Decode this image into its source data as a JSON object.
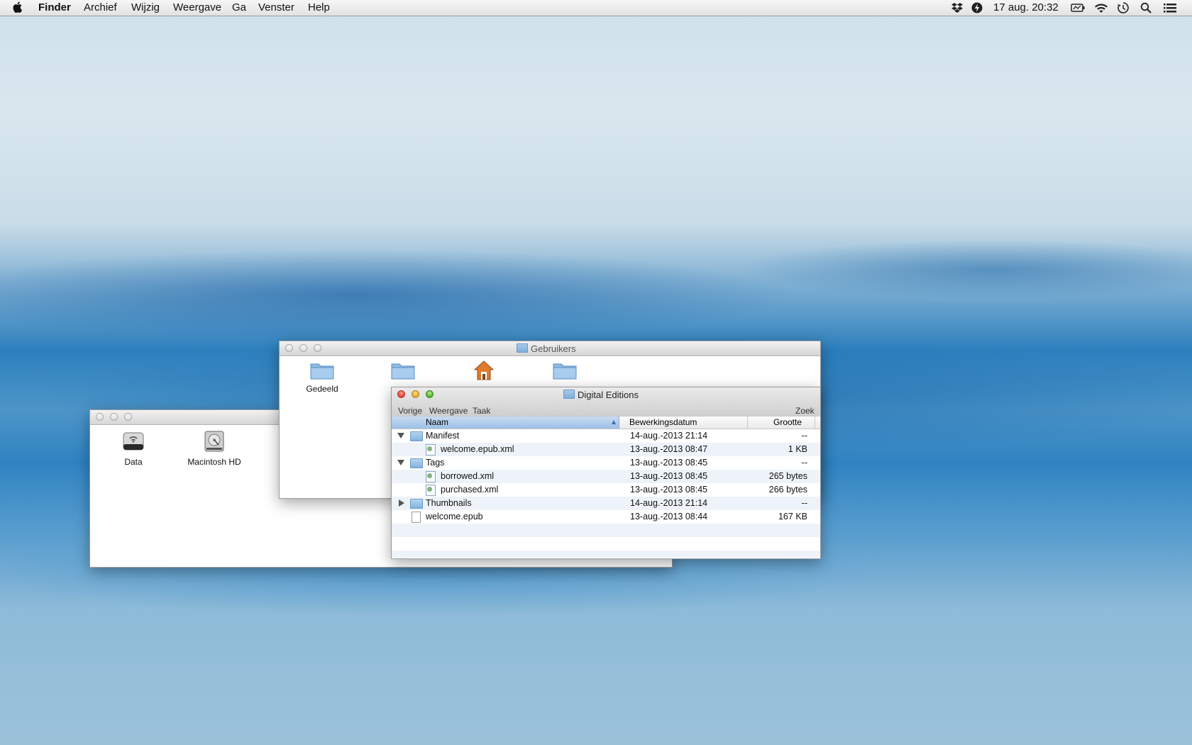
{
  "menubar": {
    "app": "Finder",
    "items": [
      "Archief",
      "Wijzig",
      "Weergave",
      "Ga",
      "Venster",
      "Help"
    ],
    "clock": "17 aug.  20:32",
    "status_icons": [
      "dropbox-icon",
      "flash-icon",
      "battery-icon",
      "wifi-icon",
      "time-machine-icon",
      "spotlight-icon",
      "list-icon"
    ]
  },
  "window_devices": {
    "items": [
      {
        "label": "Data",
        "icon": "network-drive-icon"
      },
      {
        "label": "Macintosh HD",
        "icon": "hard-drive-icon"
      }
    ]
  },
  "window_users": {
    "title": "Gebruikers",
    "items": [
      {
        "label": "Gedeeld",
        "icon": "folder-icon"
      },
      {
        "label": "",
        "icon": "folder-icon"
      },
      {
        "label": "",
        "icon": "home-icon"
      },
      {
        "label": "",
        "icon": "folder-icon"
      }
    ]
  },
  "window_digital": {
    "title": "Digital Editions",
    "toolbar": {
      "back": "Vorige",
      "view": "Weergave",
      "action": "Taak",
      "search": "Zoek"
    },
    "columns": {
      "name": "Naam",
      "date": "Bewerkingsdatum",
      "size": "Grootte"
    },
    "rows": [
      {
        "name": "Manifest",
        "date": "14-aug.-2013 21:14",
        "size": "--",
        "kind": "folder",
        "disclosure": "down",
        "indent": 0
      },
      {
        "name": "welcome.epub.xml",
        "date": "13-aug.-2013 08:47",
        "size": "1 KB",
        "kind": "xml",
        "disclosure": "",
        "indent": 1
      },
      {
        "name": "Tags",
        "date": "13-aug.-2013 08:45",
        "size": "--",
        "kind": "folder",
        "disclosure": "down",
        "indent": 0
      },
      {
        "name": "borrowed.xml",
        "date": "13-aug.-2013 08:45",
        "size": "265 bytes",
        "kind": "xml",
        "disclosure": "",
        "indent": 1
      },
      {
        "name": "purchased.xml",
        "date": "13-aug.-2013 08:45",
        "size": "266 bytes",
        "kind": "xml",
        "disclosure": "",
        "indent": 1
      },
      {
        "name": "Thumbnails",
        "date": "14-aug.-2013 21:14",
        "size": "--",
        "kind": "folder",
        "disclosure": "right",
        "indent": 0
      },
      {
        "name": "welcome.epub",
        "date": "13-aug.-2013 08:44",
        "size": "167 KB",
        "kind": "doc",
        "disclosure": "",
        "indent": 0
      }
    ]
  }
}
